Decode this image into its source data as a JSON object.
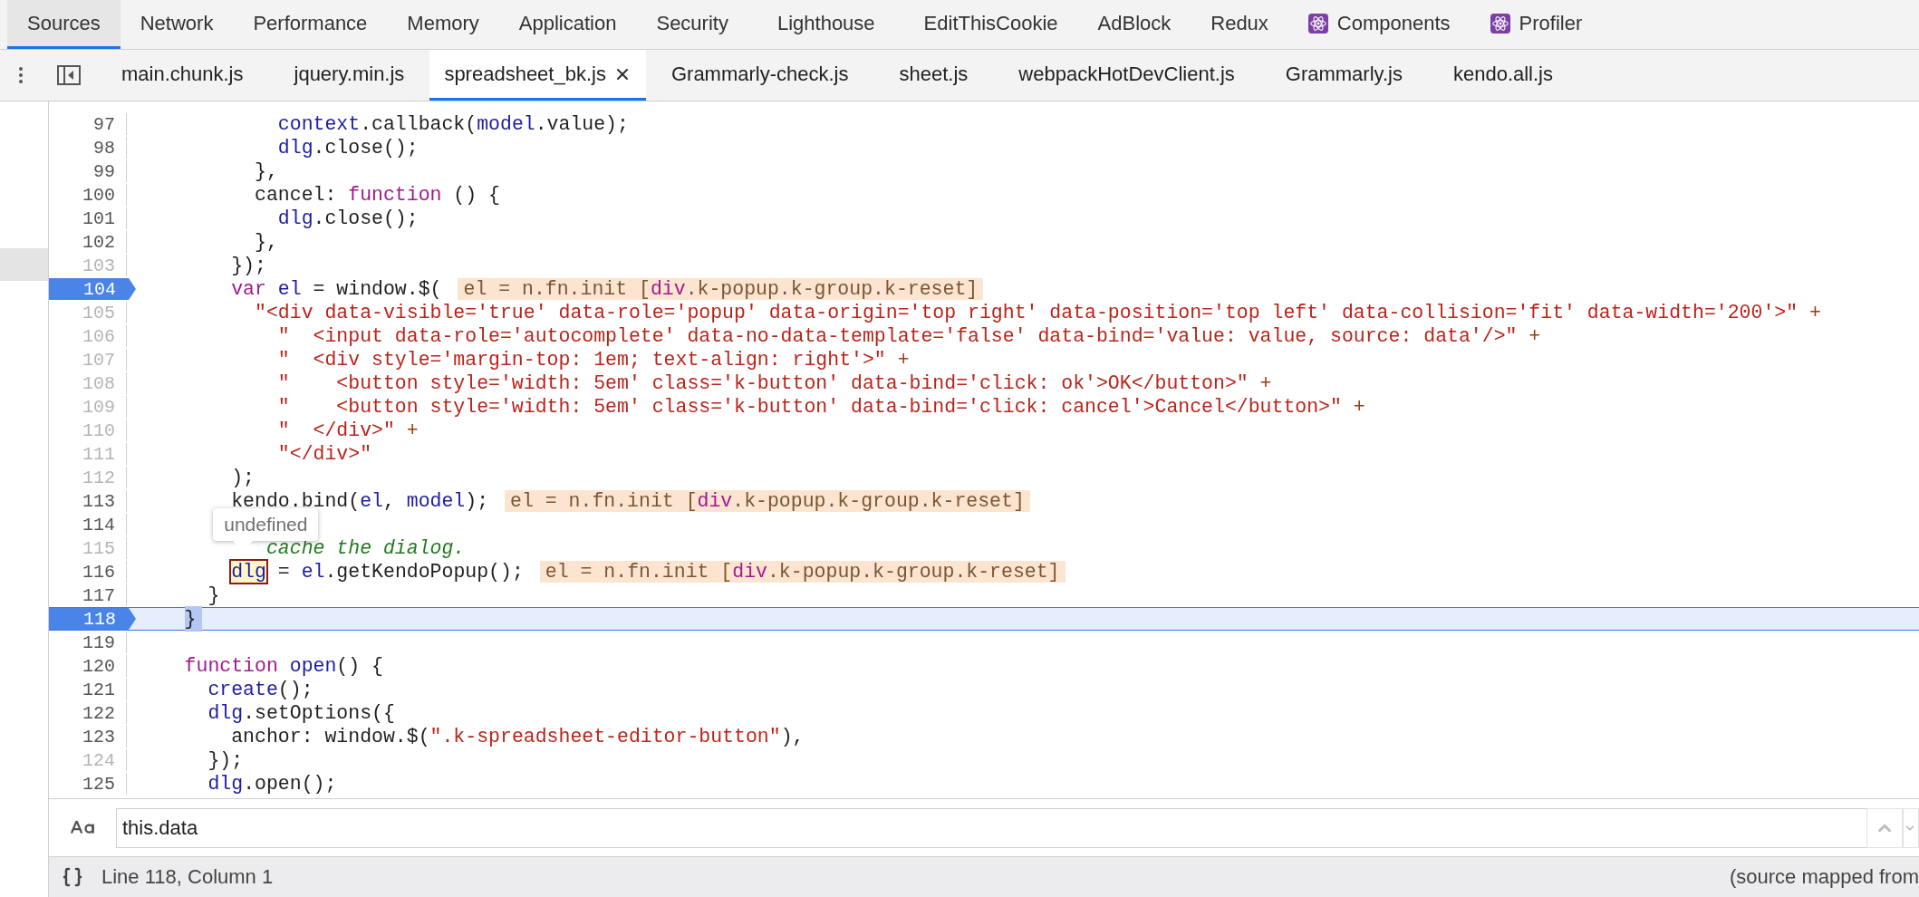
{
  "panel_tabs": [
    {
      "label": "Sources",
      "kind": "plain",
      "selected": true
    },
    {
      "label": "Network",
      "kind": "plain",
      "selected": false
    },
    {
      "label": "Performance",
      "kind": "plain",
      "selected": false
    },
    {
      "label": "Memory",
      "kind": "plain",
      "selected": false
    },
    {
      "label": "Application",
      "kind": "plain",
      "selected": false
    },
    {
      "label": "Security",
      "kind": "plain",
      "selected": false
    },
    {
      "label": "Lighthouse",
      "kind": "plain",
      "selected": false
    },
    {
      "label": "EditThisCookie",
      "kind": "plain",
      "selected": false
    },
    {
      "label": "AdBlock",
      "kind": "plain",
      "selected": false
    },
    {
      "label": "Redux",
      "kind": "plain",
      "selected": false
    },
    {
      "label": "Components",
      "kind": "react",
      "selected": false
    },
    {
      "label": "Profiler",
      "kind": "react",
      "selected": false
    }
  ],
  "file_tabs": [
    {
      "label": "main.chunk.js",
      "selected": false
    },
    {
      "label": "jquery.min.js",
      "selected": false
    },
    {
      "label": "spreadsheet_bk.js",
      "selected": true
    },
    {
      "label": "Grammarly-check.js",
      "selected": false
    },
    {
      "label": "sheet.js",
      "selected": false
    },
    {
      "label": "webpackHotDevClient.js",
      "selected": false
    },
    {
      "label": "Grammarly.js",
      "selected": false
    },
    {
      "label": "kendo.all.js",
      "selected": false
    }
  ],
  "editor": {
    "lines": [
      {
        "number": "97",
        "breakable": true,
        "breakpoint": false,
        "current": false,
        "tokens": [
          {
            "text": "            context",
            "kind": "var"
          },
          {
            "text": ".callback(",
            "kind": "plain"
          },
          {
            "text": "model",
            "kind": "var"
          },
          {
            "text": ".value);",
            "kind": "plain"
          }
        ]
      },
      {
        "number": "98",
        "breakable": true,
        "breakpoint": false,
        "current": false,
        "tokens": [
          {
            "text": "            dlg",
            "kind": "var"
          },
          {
            "text": ".close();",
            "kind": "plain"
          }
        ]
      },
      {
        "number": "99",
        "breakable": true,
        "breakpoint": false,
        "current": false,
        "tokens": [
          {
            "text": "          },",
            "kind": "plain"
          }
        ]
      },
      {
        "number": "100",
        "breakable": true,
        "breakpoint": false,
        "current": false,
        "tokens": [
          {
            "text": "          cancel: ",
            "kind": "plain"
          },
          {
            "text": "function",
            "kind": "keyword"
          },
          {
            "text": " () {",
            "kind": "plain"
          }
        ]
      },
      {
        "number": "101",
        "breakable": true,
        "breakpoint": false,
        "current": false,
        "tokens": [
          {
            "text": "            dlg",
            "kind": "var"
          },
          {
            "text": ".close();",
            "kind": "plain"
          }
        ]
      },
      {
        "number": "102",
        "breakable": true,
        "breakpoint": false,
        "current": false,
        "tokens": [
          {
            "text": "          },",
            "kind": "plain"
          }
        ]
      },
      {
        "number": "103",
        "breakable": false,
        "breakpoint": false,
        "current": false,
        "tokens": [
          {
            "text": "        });",
            "kind": "plain"
          }
        ]
      },
      {
        "number": "104",
        "breakable": true,
        "breakpoint": true,
        "current": false,
        "tokens": [
          {
            "text": "        var",
            "kind": "keyword"
          },
          {
            "text": " el",
            "kind": "var"
          },
          {
            "text": " = window.$(",
            "kind": "plain"
          }
        ],
        "value": [
          {
            "text": "el = n.fn.init [",
            "kind": "plain"
          },
          {
            "text": "div",
            "kind": "tag"
          },
          {
            "text": ".k-popup.k-group.k-reset]",
            "kind": "plain"
          }
        ]
      },
      {
        "number": "105",
        "breakable": false,
        "breakpoint": false,
        "current": false,
        "tokens": [
          {
            "text": "          \"<div data-visible='true' data-role='popup' data-origin='top right' data-position='top left' data-collision='fit' data-width='200'>\"",
            "kind": "string"
          },
          {
            "text": " +",
            "kind": "op"
          }
        ]
      },
      {
        "number": "106",
        "breakable": false,
        "breakpoint": false,
        "current": false,
        "tokens": [
          {
            "text": "            \"  <input data-role='autocomplete' data-no-data-template='false' data-bind='value: value, source: data'/>\"",
            "kind": "string"
          },
          {
            "text": " +",
            "kind": "op"
          }
        ]
      },
      {
        "number": "107",
        "breakable": false,
        "breakpoint": false,
        "current": false,
        "tokens": [
          {
            "text": "            \"  <div style='margin-top: 1em; text-align: right'>\"",
            "kind": "string"
          },
          {
            "text": " +",
            "kind": "op"
          }
        ]
      },
      {
        "number": "108",
        "breakable": false,
        "breakpoint": false,
        "current": false,
        "tokens": [
          {
            "text": "            \"    <button style='width: 5em' class='k-button' data-bind='click: ok'>OK</button>\"",
            "kind": "string"
          },
          {
            "text": " +",
            "kind": "op"
          }
        ]
      },
      {
        "number": "109",
        "breakable": false,
        "breakpoint": false,
        "current": false,
        "tokens": [
          {
            "text": "            \"    <button style='width: 5em' class='k-button' data-bind='click: cancel'>Cancel</button>\"",
            "kind": "string"
          },
          {
            "text": " +",
            "kind": "op"
          }
        ]
      },
      {
        "number": "110",
        "breakable": false,
        "breakpoint": false,
        "current": false,
        "tokens": [
          {
            "text": "            \"  </div>\"",
            "kind": "string"
          },
          {
            "text": " +",
            "kind": "op"
          }
        ]
      },
      {
        "number": "111",
        "breakable": false,
        "breakpoint": false,
        "current": false,
        "tokens": [
          {
            "text": "            \"</div>\"",
            "kind": "string"
          }
        ]
      },
      {
        "number": "112",
        "breakable": false,
        "breakpoint": false,
        "current": false,
        "tokens": [
          {
            "text": "        );",
            "kind": "plain"
          }
        ]
      },
      {
        "number": "113",
        "breakable": true,
        "breakpoint": false,
        "current": false,
        "tokens": [
          {
            "text": "        kendo.bind(",
            "kind": "plain"
          },
          {
            "text": "el",
            "kind": "var"
          },
          {
            "text": ", ",
            "kind": "plain"
          },
          {
            "text": "model",
            "kind": "var"
          },
          {
            "text": ");",
            "kind": "plain"
          }
        ],
        "value": [
          {
            "text": "el = n.fn.init [",
            "kind": "plain"
          },
          {
            "text": "div",
            "kind": "tag"
          },
          {
            "text": ".k-popup.k-group.k-reset]",
            "kind": "plain"
          }
        ]
      },
      {
        "number": "114",
        "breakable": true,
        "breakpoint": false,
        "current": false
      },
      {
        "number": "115",
        "breakable": false,
        "breakpoint": false,
        "current": false,
        "tokens": [
          {
            "text": "           cache the dialog.",
            "kind": "comment"
          }
        ]
      },
      {
        "number": "116",
        "breakable": true,
        "breakpoint": false,
        "current": false,
        "tokens": [
          {
            "text": "        dlg",
            "kind": "hover"
          },
          {
            "text": " = ",
            "kind": "plain"
          },
          {
            "text": "el",
            "kind": "var"
          },
          {
            "text": ".getKendoPopup();",
            "kind": "plain"
          }
        ],
        "tooltip": "undefined",
        "value": [
          {
            "text": "el = n.fn.init [",
            "kind": "plain"
          },
          {
            "text": "div",
            "kind": "tag"
          },
          {
            "text": ".k-popup.k-group.k-reset]",
            "kind": "plain"
          }
        ]
      },
      {
        "number": "117",
        "breakable": true,
        "breakpoint": false,
        "current": false,
        "tokens": [
          {
            "text": "      }",
            "kind": "plain"
          }
        ]
      },
      {
        "number": "118",
        "breakable": true,
        "breakpoint": true,
        "current": true,
        "tokens": [
          {
            "text": "    }",
            "kind": "exec"
          }
        ]
      },
      {
        "number": "119",
        "breakable": true,
        "breakpoint": false,
        "current": false
      },
      {
        "number": "120",
        "breakable": true,
        "breakpoint": false,
        "current": false,
        "tokens": [
          {
            "text": "    function",
            "kind": "keyword"
          },
          {
            "text": " open",
            "kind": "var"
          },
          {
            "text": "() {",
            "kind": "plain"
          }
        ]
      },
      {
        "number": "121",
        "breakable": true,
        "breakpoint": false,
        "current": false,
        "tokens": [
          {
            "text": "      create",
            "kind": "var"
          },
          {
            "text": "();",
            "kind": "plain"
          }
        ]
      },
      {
        "number": "122",
        "breakable": true,
        "breakpoint": false,
        "current": false,
        "tokens": [
          {
            "text": "      dlg",
            "kind": "var"
          },
          {
            "text": ".setOptions({",
            "kind": "plain"
          }
        ]
      },
      {
        "number": "123",
        "breakable": true,
        "breakpoint": false,
        "current": false,
        "tokens": [
          {
            "text": "        anchor: window.$(",
            "kind": "plain"
          },
          {
            "text": "\".k-spreadsheet-editor-button\"",
            "kind": "string"
          },
          {
            "text": "),",
            "kind": "plain"
          }
        ]
      },
      {
        "number": "124",
        "breakable": false,
        "breakpoint": false,
        "current": false,
        "tokens": [
          {
            "text": "      });",
            "kind": "plain"
          }
        ]
      },
      {
        "number": "125",
        "breakable": true,
        "breakpoint": false,
        "current": false,
        "tokens": [
          {
            "text": "      dlg",
            "kind": "var"
          },
          {
            "text": ".open();",
            "kind": "plain"
          }
        ]
      }
    ]
  },
  "search": {
    "value": "this.data"
  },
  "status_bar": {
    "position": "Line 118, Column 1",
    "note": "(source mapped from"
  }
}
